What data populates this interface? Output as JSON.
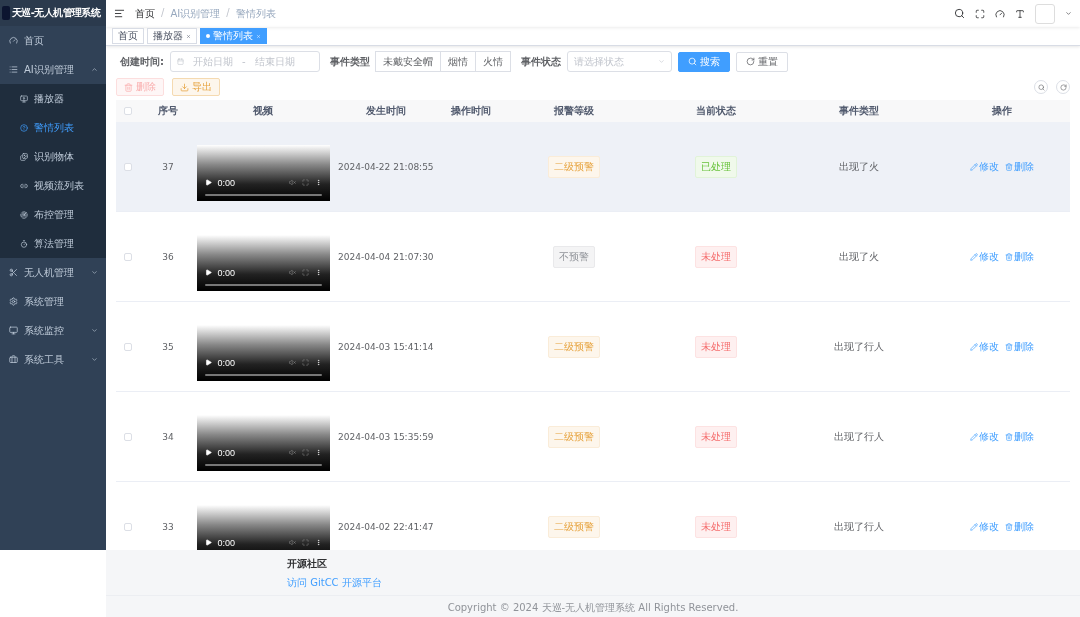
{
  "app": {
    "title": "天巡-无人机管理系统"
  },
  "sidebar": {
    "items": [
      {
        "kind": "link",
        "label": "首页",
        "selected": false
      },
      {
        "kind": "group",
        "label": "AI识别管理",
        "expanded": true,
        "children": [
          {
            "label": "播放器",
            "selected": false
          },
          {
            "label": "警情列表",
            "selected": true
          },
          {
            "label": "识别物体",
            "selected": false
          },
          {
            "label": "视频流列表",
            "selected": false
          },
          {
            "label": "布控管理",
            "selected": false
          },
          {
            "label": "算法管理",
            "selected": false
          }
        ]
      },
      {
        "kind": "group",
        "label": "无人机管理",
        "expanded": false
      },
      {
        "kind": "link",
        "label": "系统管理",
        "selected": false
      },
      {
        "kind": "group",
        "label": "系统监控",
        "expanded": false
      },
      {
        "kind": "group",
        "label": "系统工具",
        "expanded": false
      }
    ]
  },
  "breadcrumb": [
    "首页",
    "AI识别管理",
    "警情列表"
  ],
  "breadcrumb_separator": "/",
  "tags": [
    {
      "label": "首页",
      "closable": false,
      "selected": false
    },
    {
      "label": "播放器",
      "closable": true,
      "selected": false
    },
    {
      "label": "警情列表",
      "closable": true,
      "selected": true
    }
  ],
  "filters": {
    "created_label": "创建时间:",
    "start_placeholder": "开始日期",
    "separator": "-",
    "end_placeholder": "结束日期",
    "type_label": "事件类型",
    "type_options": [
      {
        "label": "未戴安全帽",
        "selected": false
      },
      {
        "label": "烟情",
        "selected": false
      },
      {
        "label": "火情",
        "selected": false
      }
    ],
    "status_label": "事件状态",
    "status_placeholder": "请选择状态",
    "search": "搜索",
    "reset": "重置"
  },
  "actions": {
    "delete": {
      "label": "删除",
      "disabled": true
    },
    "export": {
      "label": "导出",
      "disabled": false
    }
  },
  "table": {
    "all_checked": false,
    "columns": [
      "序号",
      "视频",
      "发生时间",
      "操作时间",
      "报警等级",
      "当前状态",
      "事件类型",
      "操作"
    ],
    "rows": [
      {
        "id": "37",
        "time": "0:00",
        "occurred": "2024-04-22 21:08:55",
        "level": {
          "text": "二级预警",
          "kind": "warning"
        },
        "status": {
          "text": "已处理",
          "kind": "success"
        },
        "type": "出现了火",
        "edit": "修改",
        "delete": "删除",
        "highlighted": true,
        "checked": false
      },
      {
        "id": "36",
        "time": "0:00",
        "occurred": "2024-04-04 21:07:30",
        "level": {
          "text": "不预警",
          "kind": "info"
        },
        "status": {
          "text": "未处理",
          "kind": "danger"
        },
        "type": "出现了火",
        "edit": "修改",
        "delete": "删除",
        "highlighted": false,
        "checked": false
      },
      {
        "id": "35",
        "time": "0:00",
        "occurred": "2024-04-03 15:41:14",
        "level": {
          "text": "二级预警",
          "kind": "warning"
        },
        "status": {
          "text": "未处理",
          "kind": "danger"
        },
        "type": "出现了行人",
        "edit": "修改",
        "delete": "删除",
        "highlighted": false,
        "checked": false
      },
      {
        "id": "34",
        "time": "0:00",
        "occurred": "2024-04-03 15:35:59",
        "level": {
          "text": "二级预警",
          "kind": "warning"
        },
        "status": {
          "text": "未处理",
          "kind": "danger"
        },
        "type": "出现了行人",
        "edit": "修改",
        "delete": "删除",
        "highlighted": false,
        "checked": false
      },
      {
        "id": "33",
        "time": "0:00",
        "occurred": "2024-04-02 22:41:47",
        "level": {
          "text": "二级预警",
          "kind": "warning"
        },
        "status": {
          "text": "未处理",
          "kind": "danger"
        },
        "type": "出现了行人",
        "edit": "修改",
        "delete": "删除",
        "highlighted": false,
        "checked": false
      }
    ]
  },
  "footer": {
    "heading": "开源社区",
    "link": "访问 GitCC 开源平台",
    "copyright": "Copyright © 2024 天巡-无人机管理系统 All Rights Reserved."
  }
}
